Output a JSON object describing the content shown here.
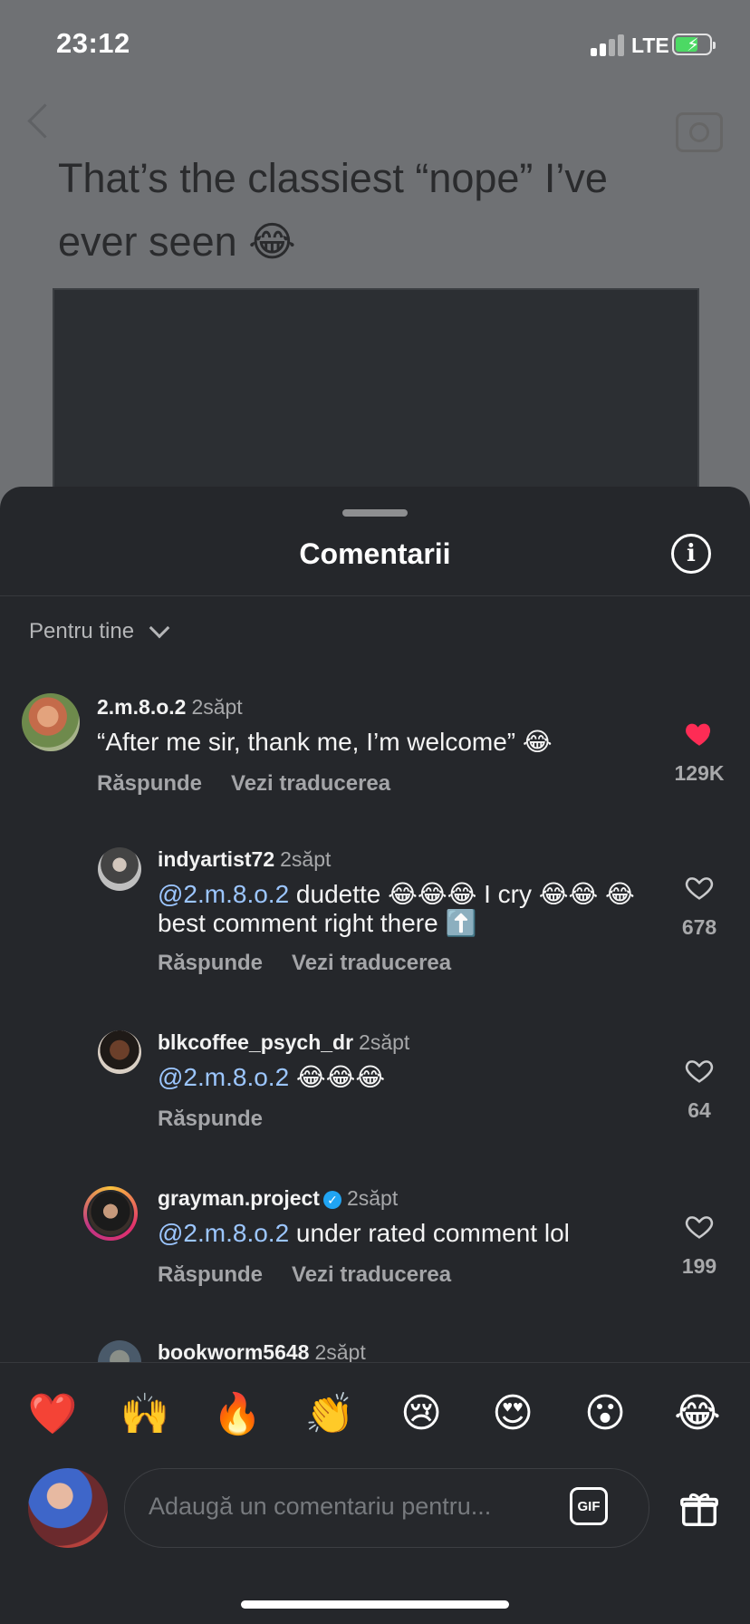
{
  "status_bar": {
    "time": "23:12",
    "network": "LTE"
  },
  "post": {
    "caption": "That’s the classiest “nope” I’ve ever seen 😂"
  },
  "sheet": {
    "title": "Comentarii",
    "filter_label": "Pentru tine"
  },
  "comments": [
    {
      "username": "2.m.8.o.2",
      "time": "2săpt",
      "mention": "",
      "text": "“After me sir, thank me, I’m welcome” 😂",
      "reply_label": "Răspunde",
      "translate_label": "Vezi traducerea",
      "likes": "129K",
      "liked": true
    },
    {
      "username": "indyartist72",
      "time": "2săpt",
      "mention": "@2.m.8.o.2",
      "text": " dudette 😂😂😂 I cry 😂😂 😂 best comment right there ⬆️",
      "reply_label": "Răspunde",
      "translate_label": "Vezi traducerea",
      "likes": "678",
      "liked": false
    },
    {
      "username": "blkcoffee_psych_dr",
      "time": "2săpt",
      "mention": "@2.m.8.o.2",
      "text": " 😂😂😂",
      "reply_label": "Răspunde",
      "translate_label": "",
      "likes": "64",
      "liked": false
    },
    {
      "username": "grayman.project",
      "time": "2săpt",
      "mention": "@2.m.8.o.2",
      "text": " under rated comment lol",
      "reply_label": "Răspunde",
      "translate_label": "Vezi traducerea",
      "likes": "199",
      "liked": false,
      "verified": true
    },
    {
      "username": "bookworm5648",
      "time": "2săpt"
    }
  ],
  "emoji_bar": [
    "❤️",
    "🙌",
    "🔥",
    "👏",
    "😢",
    "😍",
    "😮",
    "😂"
  ],
  "input": {
    "placeholder": "Adaugă un comentariu pentru...",
    "gif_label": "GIF"
  },
  "icons": {
    "heart_liked_color": "#fe2c55",
    "mention_color": "#9cc6ff",
    "verified_color": "#20a4f3"
  }
}
